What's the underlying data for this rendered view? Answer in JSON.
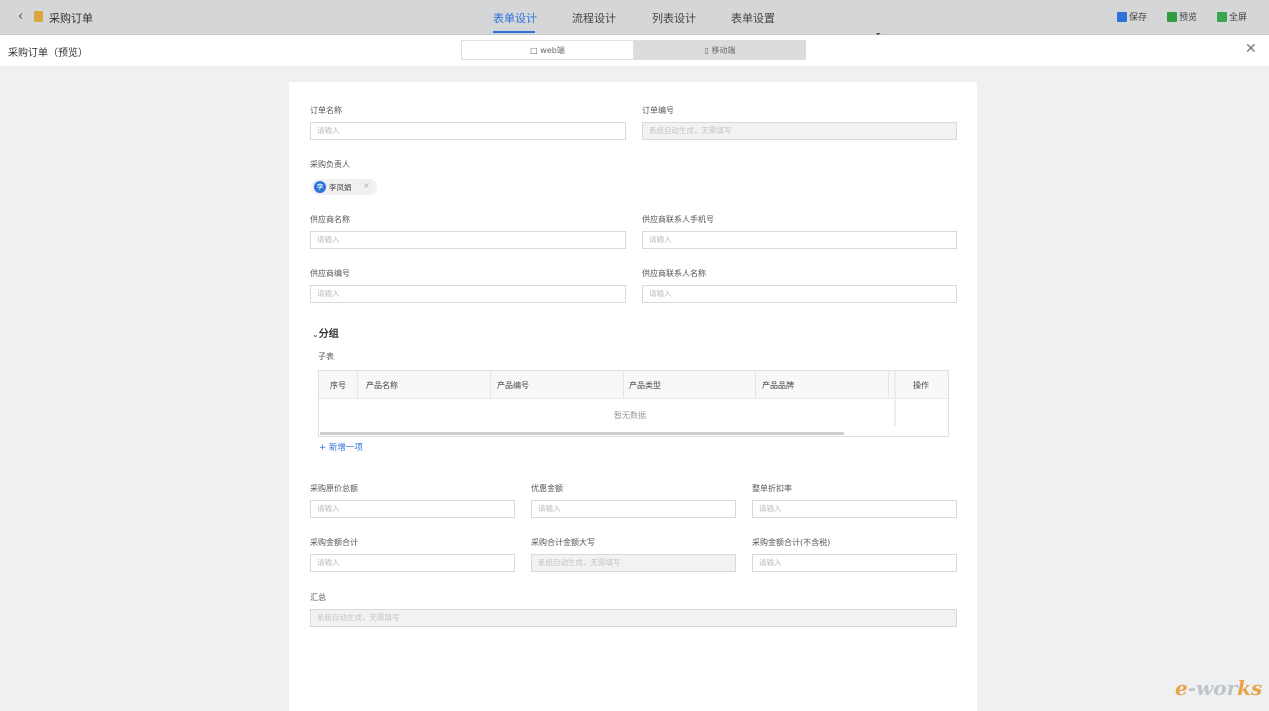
{
  "header": {
    "back_icon": "chevron-left-icon",
    "title": "采购订单",
    "tabs": [
      {
        "label": "表单设计",
        "active": true
      },
      {
        "label": "流程设计",
        "active": false
      },
      {
        "label": "列表设计",
        "active": false
      },
      {
        "label": "表单设置",
        "active": false
      }
    ],
    "tools": [
      {
        "label": "保存",
        "icon": "save-icon",
        "color": "#2d73d9"
      },
      {
        "label": "预览",
        "icon": "play-icon",
        "color": "#2e9e3e"
      },
      {
        "label": "全屏",
        "icon": "fullscreen-icon",
        "color": "#3aa54a"
      }
    ]
  },
  "preview_bar": {
    "title": "采购订单（预览）",
    "web_label": "web端",
    "mobile_label": "移动端",
    "close_icon": "close-icon"
  },
  "form": {
    "order_name": {
      "label": "订单名称",
      "placeholder": "请输入"
    },
    "order_no": {
      "label": "订单编号",
      "placeholder": "系统自动生成，无需填写"
    },
    "buyer": {
      "label": "采购负责人",
      "person": "李凤娟",
      "avatar": "李"
    },
    "supplier_name": {
      "label": "供应商名称",
      "placeholder": "请输入"
    },
    "supplier_phone": {
      "label": "供应商联系人手机号",
      "placeholder": "请输入"
    },
    "supplier_no": {
      "label": "供应商编号",
      "placeholder": "请输入"
    },
    "supplier_contact": {
      "label": "供应商联系人名称",
      "placeholder": "请输入"
    },
    "group_title": "分组",
    "subtable": {
      "title": "子表",
      "columns": [
        "序号",
        "产品名称",
        "产品编号",
        "产品类型",
        "产品品牌",
        "操作"
      ],
      "empty_text": "暂无数据",
      "add_label": "+ 新增一项"
    },
    "original_total": {
      "label": "采购原价总额",
      "placeholder": "请输入"
    },
    "discount_amount": {
      "label": "优惠金额",
      "placeholder": "请输入"
    },
    "discount_rate": {
      "label": "整单折扣率",
      "placeholder": "请输入"
    },
    "amount_total": {
      "label": "采购金额合计",
      "placeholder": "请输入"
    },
    "amount_upper": {
      "label": "采购合计金额大写",
      "placeholder": "系统自动生成，无需填写"
    },
    "amount_notax": {
      "label": "采购金额合计(不含税)",
      "placeholder": "请输入"
    },
    "summary": {
      "label": "汇总",
      "placeholder": "系统自动生成，无需填写"
    }
  },
  "watermark": {
    "prefix": "e",
    "text": "-wor",
    "suffix": "ks"
  }
}
